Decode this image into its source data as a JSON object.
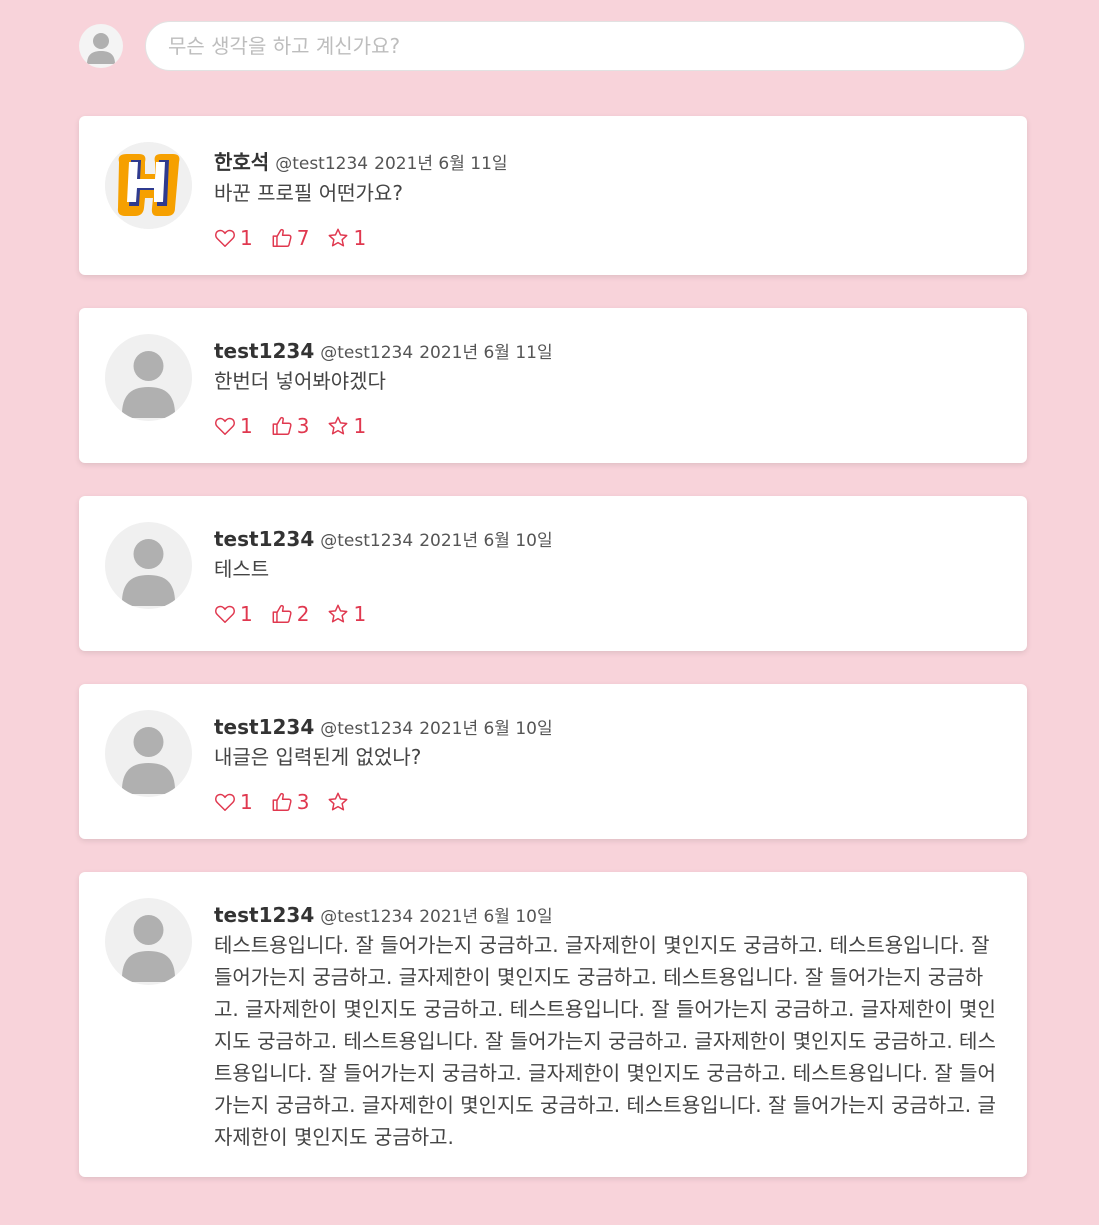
{
  "compose": {
    "avatar_icon": "default-user-icon",
    "placeholder": "무슨 생각을 하고 계신가요?"
  },
  "colors": {
    "background": "#f8d3da",
    "accent": "#e0384f",
    "card": "#ffffff"
  },
  "posts": [
    {
      "name": "한호석",
      "handle": "@test1234",
      "date": "2021년 6월 11일",
      "text": "바꾼 프로필 어떤가요?",
      "avatar": "h-logo",
      "likes": "1",
      "thumbs": "7",
      "stars": "1"
    },
    {
      "name": "test1234",
      "handle": "@test1234",
      "date": "2021년 6월 11일",
      "text": "한번더 넣어봐야겠다",
      "avatar": "default-user-icon",
      "likes": "1",
      "thumbs": "3",
      "stars": "1"
    },
    {
      "name": "test1234",
      "handle": "@test1234",
      "date": "2021년 6월 10일",
      "text": "테스트",
      "avatar": "default-user-icon",
      "likes": "1",
      "thumbs": "2",
      "stars": "1"
    },
    {
      "name": "test1234",
      "handle": "@test1234",
      "date": "2021년 6월 10일",
      "text": "내글은 입력된게 없었나?",
      "avatar": "default-user-icon",
      "likes": "1",
      "thumbs": "3",
      "stars": ""
    },
    {
      "name": "test1234",
      "handle": "@test1234",
      "date": "2021년 6월 10일",
      "text": "테스트용입니다. 잘 들어가는지 궁금하고. 글자제한이 몇인지도 궁금하고. 테스트용입니다. 잘 들어가는지 궁금하고. 글자제한이 몇인지도 궁금하고. 테스트용입니다. 잘 들어가는지 궁금하고. 글자제한이 몇인지도 궁금하고. 테스트용입니다. 잘 들어가는지 궁금하고. 글자제한이 몇인지도 궁금하고. 테스트용입니다. 잘 들어가는지 궁금하고. 글자제한이 몇인지도 궁금하고. 테스트용입니다. 잘 들어가는지 궁금하고. 글자제한이 몇인지도 궁금하고. 테스트용입니다. 잘 들어가는지 궁금하고. 글자제한이 몇인지도 궁금하고. 테스트용입니다. 잘 들어가는지 궁금하고. 글자제한이 몇인지도 궁금하고.",
      "avatar": "default-user-icon",
      "likes": "",
      "thumbs": "",
      "stars": ""
    }
  ]
}
